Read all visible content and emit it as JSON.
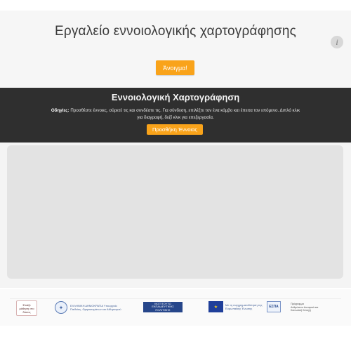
{
  "header": {
    "title": "Εργαλείο εννοιολογικής χαρτογράφησης",
    "info_label": "i",
    "open_button": "Άνοιγμα!"
  },
  "band": {
    "title": "Εννοιολογική Χαρτογράφηση",
    "instructions_label": "Οδηγίες:",
    "instructions_text": "Προσθέστε έννοιες, σύρετέ τις και συνδέστε τις. Για σύνδεση, επιλέξτε τον ένα κόμβο και έπειτα τον επόμενο. Διπλό κλικ για διαγραφή, δεξί κλικ για επεξεργασία.",
    "add_button": "Προσθήκη Έννοιας"
  },
  "footer": {
    "logo1": [
      "Φτιάξε",
      "μάθηση στο",
      "δάσος"
    ],
    "logo2_text": "ΕΛΛΗΝΙΚΗ ΔΗΜΟΚΡΑΤΙΑ Υπουργείο Παιδείας, Θρησκευμάτων και Αθλητισμού",
    "logo3": [
      "ΙΝΣΤΙΤΟΥΤΟ",
      "ΕΚΠΑΙΔΕΥΤΙΚΗΣ",
      "ΠΟΛΙΤΙΚΗΣ"
    ],
    "logo4_text": "Με τη συγχρηματοδότηση της Ευρωπαϊκής Ένωσης",
    "espa_label": "ΕΣΠΑ",
    "logo5": [
      "Πρόγραμμα",
      "Ανθρώπινο Δυναμικό και",
      "Κοινωνική Συνοχή"
    ]
  },
  "colors": {
    "accent": "#f9a31a",
    "band": "#2f2f2f",
    "canvas": "#e3e3e3"
  }
}
